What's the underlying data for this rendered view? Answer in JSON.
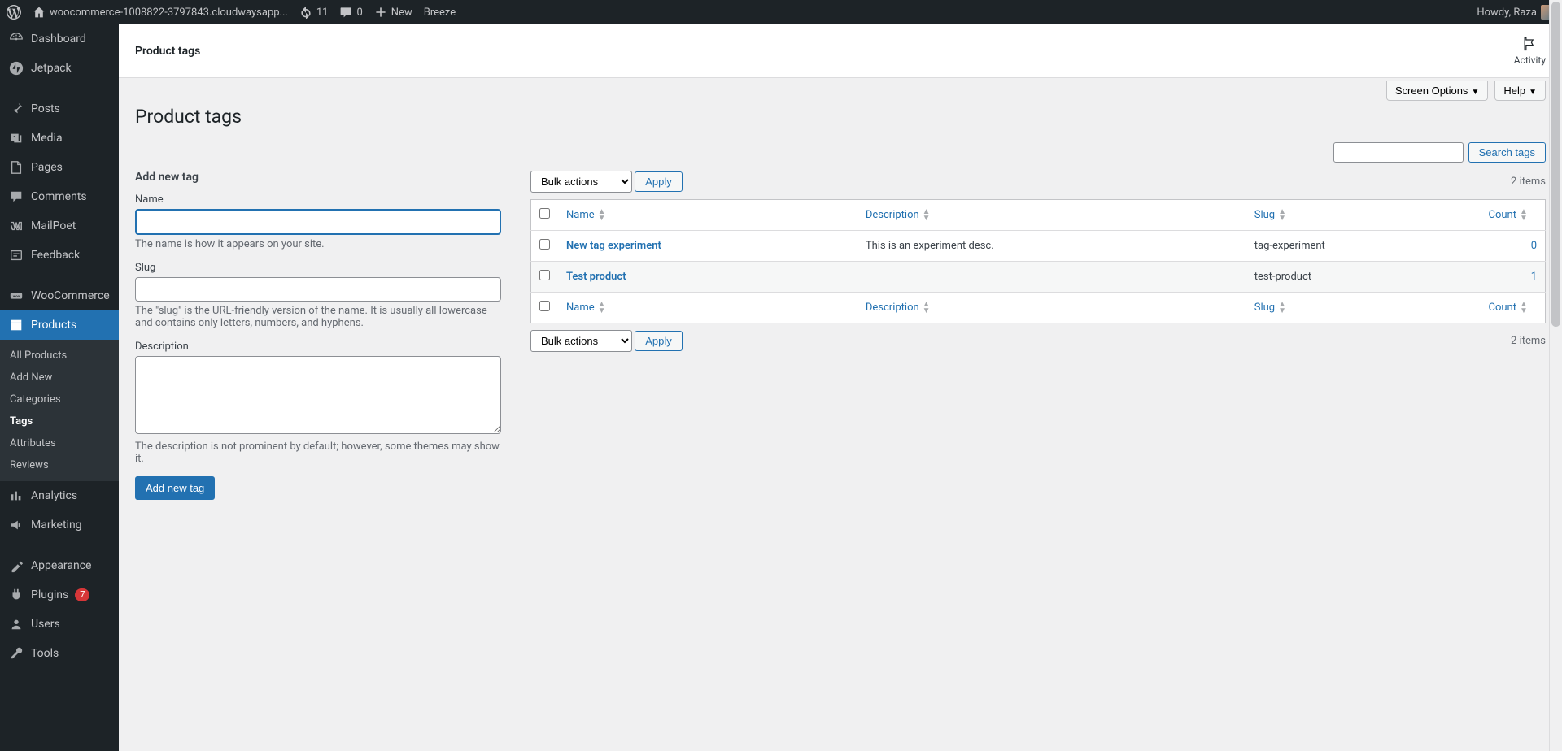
{
  "topbar": {
    "site_name": "woocommerce-1008822-3797843.cloudwaysapp...",
    "updates_count": "11",
    "comments_count": "0",
    "new_label": "New",
    "breeze_label": "Breeze",
    "howdy": "Howdy, Raza"
  },
  "sidebar": {
    "items": [
      {
        "label": "Dashboard",
        "icon": "dashboard"
      },
      {
        "label": "Jetpack",
        "icon": "jetpack"
      },
      {
        "label": "Posts",
        "icon": "pin"
      },
      {
        "label": "Media",
        "icon": "media"
      },
      {
        "label": "Pages",
        "icon": "page"
      },
      {
        "label": "Comments",
        "icon": "comment"
      },
      {
        "label": "MailPoet",
        "icon": "mailpoet"
      },
      {
        "label": "Feedback",
        "icon": "feedback"
      },
      {
        "label": "WooCommerce",
        "icon": "woo"
      },
      {
        "label": "Products",
        "icon": "products"
      },
      {
        "label": "Analytics",
        "icon": "analytics"
      },
      {
        "label": "Marketing",
        "icon": "marketing"
      },
      {
        "label": "Appearance",
        "icon": "appearance"
      },
      {
        "label": "Plugins",
        "icon": "plugins"
      },
      {
        "label": "Users",
        "icon": "users"
      },
      {
        "label": "Tools",
        "icon": "tools"
      }
    ],
    "plugins_badge": "7",
    "submenu": [
      "All Products",
      "Add New",
      "Categories",
      "Tags",
      "Attributes",
      "Reviews"
    ]
  },
  "header": {
    "breadcrumb": "Product tags",
    "activity_label": "Activity",
    "screen_options": "Screen Options",
    "help": "Help"
  },
  "page": {
    "title": "Product tags",
    "form_title": "Add new tag",
    "name_label": "Name",
    "name_hint": "The name is how it appears on your site.",
    "slug_label": "Slug",
    "slug_hint": "The \"slug\" is the URL-friendly version of the name. It is usually all lowercase and contains only letters, numbers, and hyphens.",
    "desc_label": "Description",
    "desc_hint": "The description is not prominent by default; however, some themes may show it.",
    "submit_label": "Add new tag"
  },
  "table": {
    "bulk_label": "Bulk actions",
    "apply_label": "Apply",
    "items_count": "2 items",
    "search_button": "Search tags",
    "cols": {
      "name": "Name",
      "desc": "Description",
      "slug": "Slug",
      "count": "Count"
    },
    "rows": [
      {
        "name": "New tag experiment",
        "desc": "This is an experiment desc.",
        "slug": "tag-experiment",
        "count": "0"
      },
      {
        "name": "Test product",
        "desc": "—",
        "slug": "test-product",
        "count": "1"
      }
    ]
  }
}
